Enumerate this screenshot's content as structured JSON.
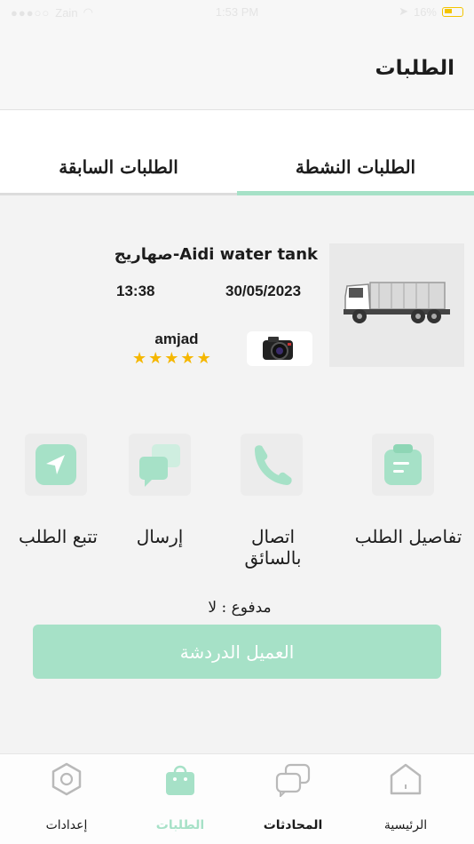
{
  "status_bar": {
    "carrier": "Zain",
    "time": "1:53 PM",
    "battery": "16%"
  },
  "header": {
    "title": "الطلبات"
  },
  "tabs": [
    {
      "label": "الطلبات النشطة",
      "active": true
    },
    {
      "label": "الطلبات السابقة",
      "active": false
    }
  ],
  "order": {
    "service": "صهاريج-Aidi water tank",
    "date": "30/05/2023",
    "time": "13:38",
    "driver_name": "amjad",
    "rating": 5
  },
  "actions": [
    {
      "label": "تفاصيل الطلب",
      "icon": "clipboard-icon"
    },
    {
      "label": "اتصال بالسائق",
      "icon": "phone-icon"
    },
    {
      "label": "إرسال",
      "icon": "chat-bubbles-icon"
    },
    {
      "label": "تتبع الطلب",
      "icon": "navigation-arrow-icon"
    }
  ],
  "payment": {
    "text": "مدفوع : لا"
  },
  "chat_button": {
    "label": "العميل الدردشة"
  },
  "bottom_nav": [
    {
      "label": "الرئيسية",
      "icon": "home-icon"
    },
    {
      "label": "المحادثات",
      "icon": "chat-icon"
    },
    {
      "label": "الطلبات",
      "icon": "bag-icon",
      "active": true
    },
    {
      "label": "إعدادات",
      "icon": "settings-hexagon-icon"
    }
  ],
  "colors": {
    "accent": "#a6e1c7",
    "star": "#f5b700",
    "background": "#f3f3f3"
  }
}
